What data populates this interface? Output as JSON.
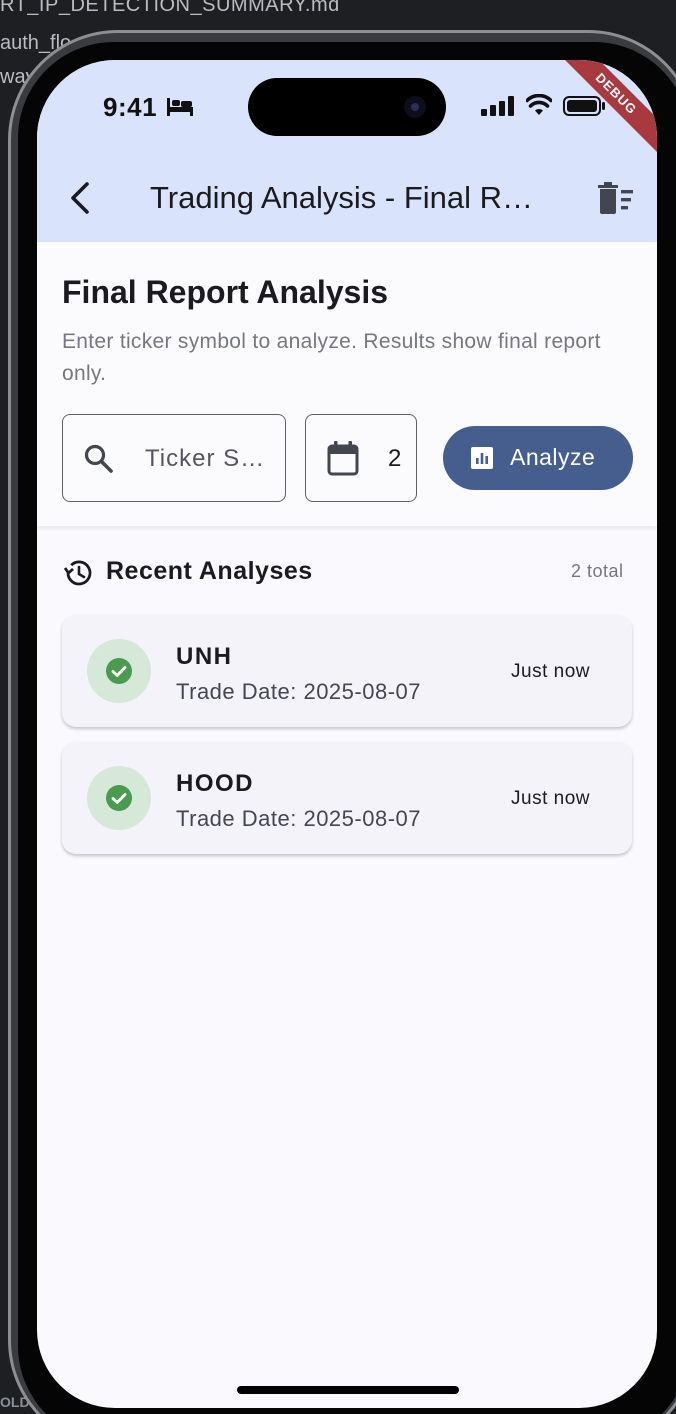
{
  "background": {
    "editor_line_1": "RT_IP_DETECTION_SUMMARY.md",
    "editor_line_2": "auth_flo",
    "editor_line_3": "way",
    "editor_bottom": "OLDE"
  },
  "status_bar": {
    "time": "9:41",
    "debug_label": "DEBUG"
  },
  "appbar": {
    "title": "Trading Analysis - Final Report"
  },
  "header": {
    "title": "Final Report Analysis",
    "subtitle": "Enter ticker symbol to analyze. Results show final report only.",
    "ticker_placeholder": "Ticker Symbol",
    "date_value": "2",
    "analyze_label": "Analyze"
  },
  "recent": {
    "heading": "Recent Analyses",
    "total": "2 total",
    "items": [
      {
        "ticker": "UNH",
        "trade_date": "Trade Date: 2025-08-07",
        "time": "Just now",
        "status": "success"
      },
      {
        "ticker": "HOOD",
        "trade_date": "Trade Date: 2025-08-07",
        "time": "Just now",
        "status": "success"
      }
    ]
  },
  "colors": {
    "appbar": "#d9e3fb",
    "primary_button": "#455e8e",
    "success_bg": "#d6e8d8",
    "success_icon": "#4a9b50",
    "card_bg": "#f3f3f9",
    "debug": "#a83a3f"
  }
}
